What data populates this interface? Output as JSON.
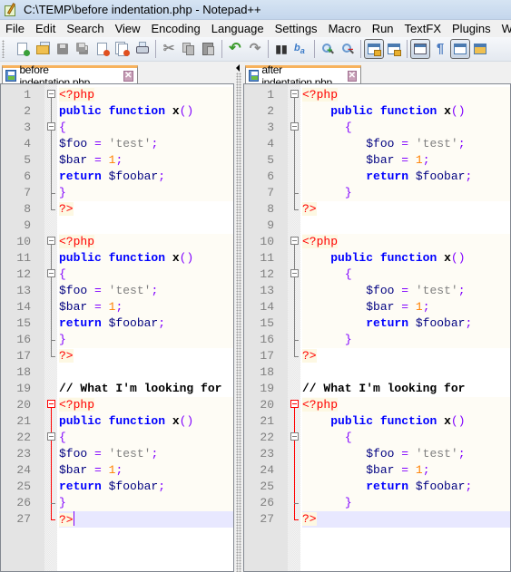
{
  "window": {
    "title": "C:\\TEMP\\before indentation.php - Notepad++",
    "app_icon": "notepad-plus-plus-icon"
  },
  "menu": [
    "File",
    "Edit",
    "Search",
    "View",
    "Encoding",
    "Language",
    "Settings",
    "Macro",
    "Run",
    "TextFX",
    "Plugins",
    "Window"
  ],
  "toolbar": {
    "buttons": [
      {
        "name": "new-file-icon"
      },
      {
        "name": "open-file-icon"
      },
      {
        "name": "save-icon"
      },
      {
        "name": "save-all-icon"
      },
      {
        "name": "close-icon"
      },
      {
        "name": "close-all-icon"
      },
      {
        "name": "print-icon"
      },
      {
        "name": "separator"
      },
      {
        "name": "cut-icon"
      },
      {
        "name": "copy-icon"
      },
      {
        "name": "paste-icon"
      },
      {
        "name": "separator"
      },
      {
        "name": "undo-icon"
      },
      {
        "name": "redo-icon"
      },
      {
        "name": "separator"
      },
      {
        "name": "find-icon"
      },
      {
        "name": "replace-icon"
      },
      {
        "name": "separator"
      },
      {
        "name": "zoom-in-icon"
      },
      {
        "name": "zoom-out-icon"
      },
      {
        "name": "separator"
      },
      {
        "name": "sync-vertical-scroll-icon",
        "checked": true
      },
      {
        "name": "sync-horizontal-scroll-icon"
      },
      {
        "name": "separator"
      },
      {
        "name": "word-wrap-icon",
        "checked": true
      },
      {
        "name": "show-all-characters-icon"
      },
      {
        "name": "indent-guide-icon",
        "checked": true
      },
      {
        "name": "user-defined-language-icon"
      }
    ]
  },
  "panes": {
    "left": {
      "tab_label": "before indentation.php",
      "tab_close": "✕"
    },
    "right": {
      "tab_label": "after indentation.php",
      "tab_close": "✕"
    }
  },
  "code": {
    "lines": [
      {
        "n": "1"
      },
      {
        "n": "2"
      },
      {
        "n": "3"
      },
      {
        "n": "4"
      },
      {
        "n": "5"
      },
      {
        "n": "6"
      },
      {
        "n": "7"
      },
      {
        "n": "8"
      },
      {
        "n": "9"
      },
      {
        "n": "10"
      },
      {
        "n": "11"
      },
      {
        "n": "12"
      },
      {
        "n": "13"
      },
      {
        "n": "14"
      },
      {
        "n": "15"
      },
      {
        "n": "16"
      },
      {
        "n": "17"
      },
      {
        "n": "18"
      },
      {
        "n": "19"
      },
      {
        "n": "20"
      },
      {
        "n": "21"
      },
      {
        "n": "22"
      },
      {
        "n": "23"
      },
      {
        "n": "24"
      },
      {
        "n": "25"
      },
      {
        "n": "26"
      },
      {
        "n": "27"
      }
    ],
    "tokens": {
      "open_tag": "<?php",
      "close_tag": "?>",
      "kw_public": "public",
      "kw_function": "function",
      "fn_name": "x",
      "parens": "()",
      "brace_open": "{",
      "brace_close": "}",
      "var_foo": "$foo",
      "var_bar": "$bar",
      "var_foobar": "$foobar",
      "kw_return": "return",
      "eq": "=",
      "str_test": "'test'",
      "num_1": "1",
      "semi": ";",
      "comment": "// What I'm looking for"
    }
  }
}
